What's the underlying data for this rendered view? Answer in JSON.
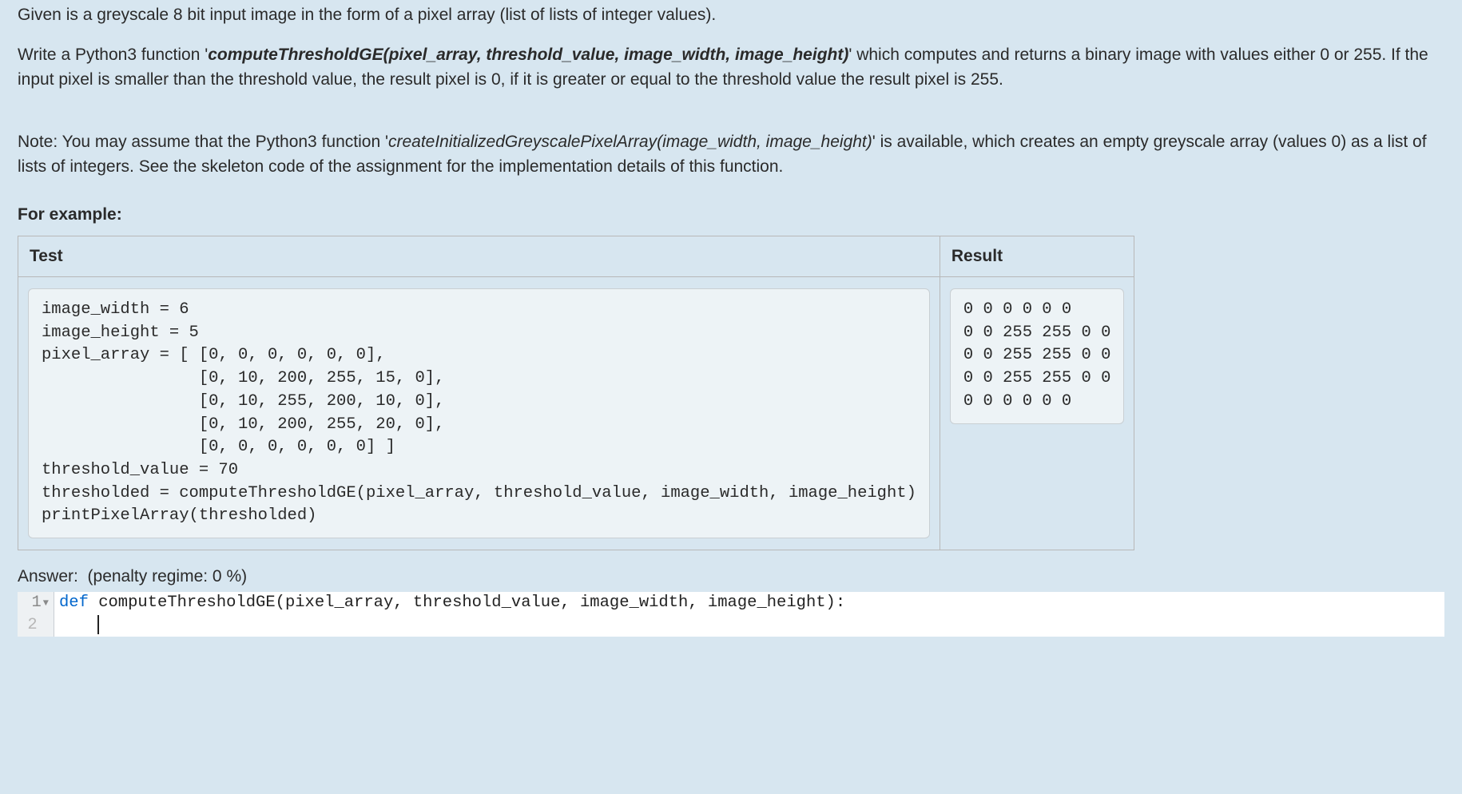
{
  "problem": {
    "para1_pre": "Given is a greyscale 8 bit input image in the form of a pixel array (list of lists of integer values).",
    "para2_pre": "Write a Python3 function '",
    "para2_fn": "computeThresholdGE(pixel_array, threshold_value, image_width, image_height)",
    "para2_post": "' which computes and returns a binary image with values either 0 or 255. If the input pixel is smaller than the threshold value, the result pixel is 0, if it is greater or equal to the threshold value the result pixel is 255.",
    "para3_pre": "Note: You may assume that the Python3 function '",
    "para3_fn": "createInitializedGreyscalePixelArray(image_width, image_height)",
    "para3_post": "' is available, which creates an empty greyscale array (values 0) as a list of lists of integers. See the skeleton code of the assignment for the implementation details of this function."
  },
  "example_label": "For example:",
  "table": {
    "headers": {
      "test": "Test",
      "result": "Result"
    },
    "test_code": "image_width = 6\nimage_height = 5\npixel_array = [ [0, 0, 0, 0, 0, 0],\n                [0, 10, 200, 255, 15, 0],\n                [0, 10, 255, 200, 10, 0],\n                [0, 10, 200, 255, 20, 0],\n                [0, 0, 0, 0, 0, 0] ]\nthreshold_value = 70\nthresholded = computeThresholdGE(pixel_array, threshold_value, image_width, image_height)\nprintPixelArray(thresholded)",
    "result_code": "0 0 0 0 0 0\n0 0 255 255 0 0\n0 0 255 255 0 0\n0 0 255 255 0 0\n0 0 0 0 0 0"
  },
  "answer": {
    "label": "Answer:",
    "penalty": "(penalty regime: 0 %)"
  },
  "editor": {
    "line1_num": "1",
    "line1_kw": "def",
    "line1_rest": " computeThresholdGE(pixel_array, threshold_value, image_width, image_height):",
    "line2_num": "2"
  }
}
